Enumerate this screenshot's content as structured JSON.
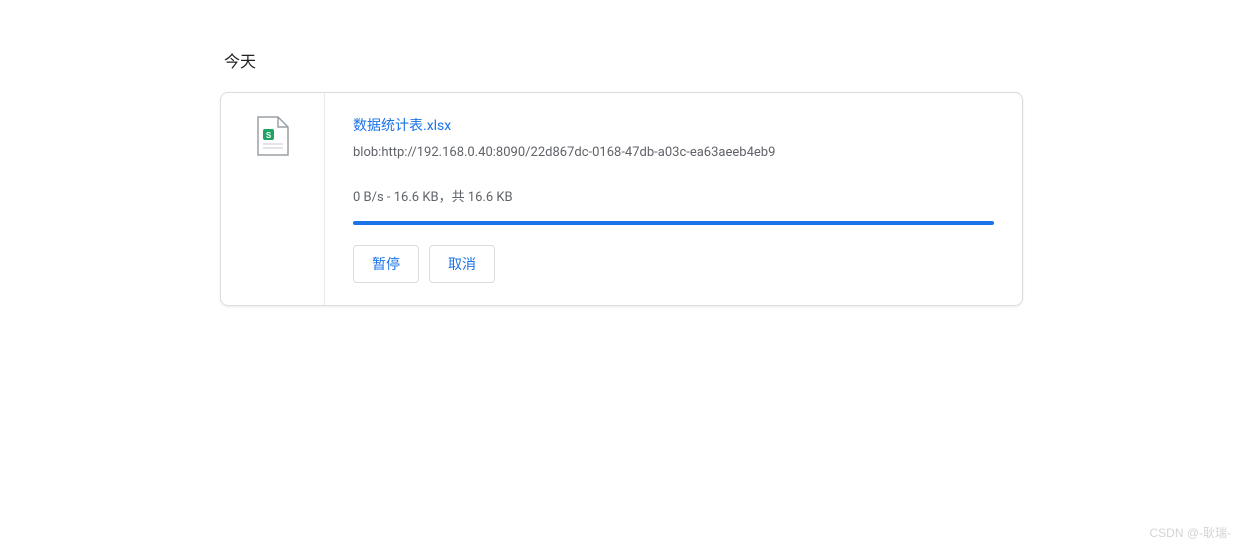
{
  "section": {
    "header": "今天"
  },
  "download": {
    "file_name": "数据统计表.xlsx",
    "source_url": "blob:http://192.168.0.40:8090/22d867dc-0168-47db-a03c-ea63aeeb4eb9",
    "progress_text": "0 B/s - 16.6 KB，共 16.6 KB",
    "progress_percent": 100,
    "buttons": {
      "pause": "暂停",
      "cancel": "取消"
    }
  },
  "watermark": "CSDN @-耿瑞-"
}
